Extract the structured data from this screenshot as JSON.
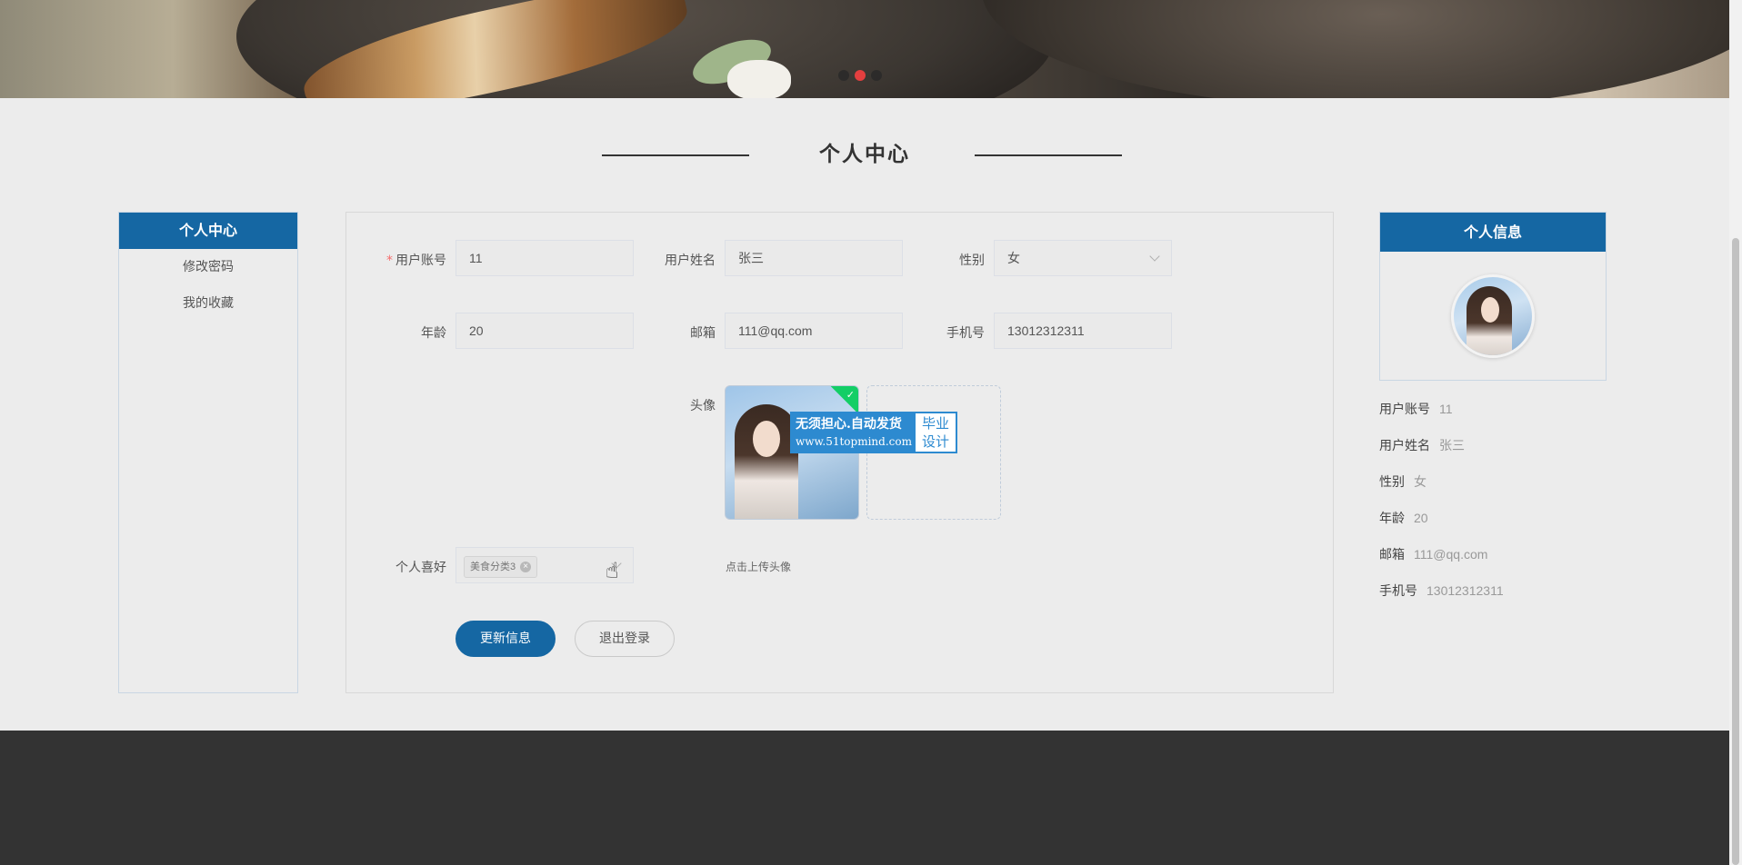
{
  "banner": {
    "active_dot": 1,
    "dot_count": 3
  },
  "page_title": "个人中心",
  "left_menu": {
    "header": "个人中心",
    "items": [
      "修改密码",
      "我的收藏"
    ]
  },
  "form": {
    "account": {
      "label": "用户账号",
      "required_mark": "*",
      "value": "11"
    },
    "name": {
      "label": "用户姓名",
      "value": "张三"
    },
    "gender": {
      "label": "性别",
      "value": "女"
    },
    "age": {
      "label": "年龄",
      "value": "20"
    },
    "email": {
      "label": "邮箱",
      "value": "111@qq.com"
    },
    "phone": {
      "label": "手机号",
      "value": "13012312311"
    },
    "avatar": {
      "label": "头像",
      "upload_tip": "点击上传头像",
      "upload_plus": "+"
    },
    "hobby": {
      "label": "个人喜好",
      "tags": [
        "美食分类3"
      ]
    },
    "watermark": {
      "line1": "无须担心.自动发货",
      "line2": "www.51topmind.com",
      "right": "毕业设计"
    },
    "update_button": "更新信息",
    "logout_button": "退出登录"
  },
  "info_card": {
    "header": "个人信息",
    "rows": [
      {
        "key": "用户账号",
        "value": "11"
      },
      {
        "key": "用户姓名",
        "value": "张三"
      },
      {
        "key": "性别",
        "value": "女"
      },
      {
        "key": "年龄",
        "value": "20"
      },
      {
        "key": "邮箱",
        "value": "111@qq.com"
      },
      {
        "key": "手机号",
        "value": "13012312311"
      }
    ]
  },
  "colors": {
    "primary": "#1567a3",
    "required": "#f56c6c",
    "success": "#13ce66",
    "footer": "#333333"
  }
}
